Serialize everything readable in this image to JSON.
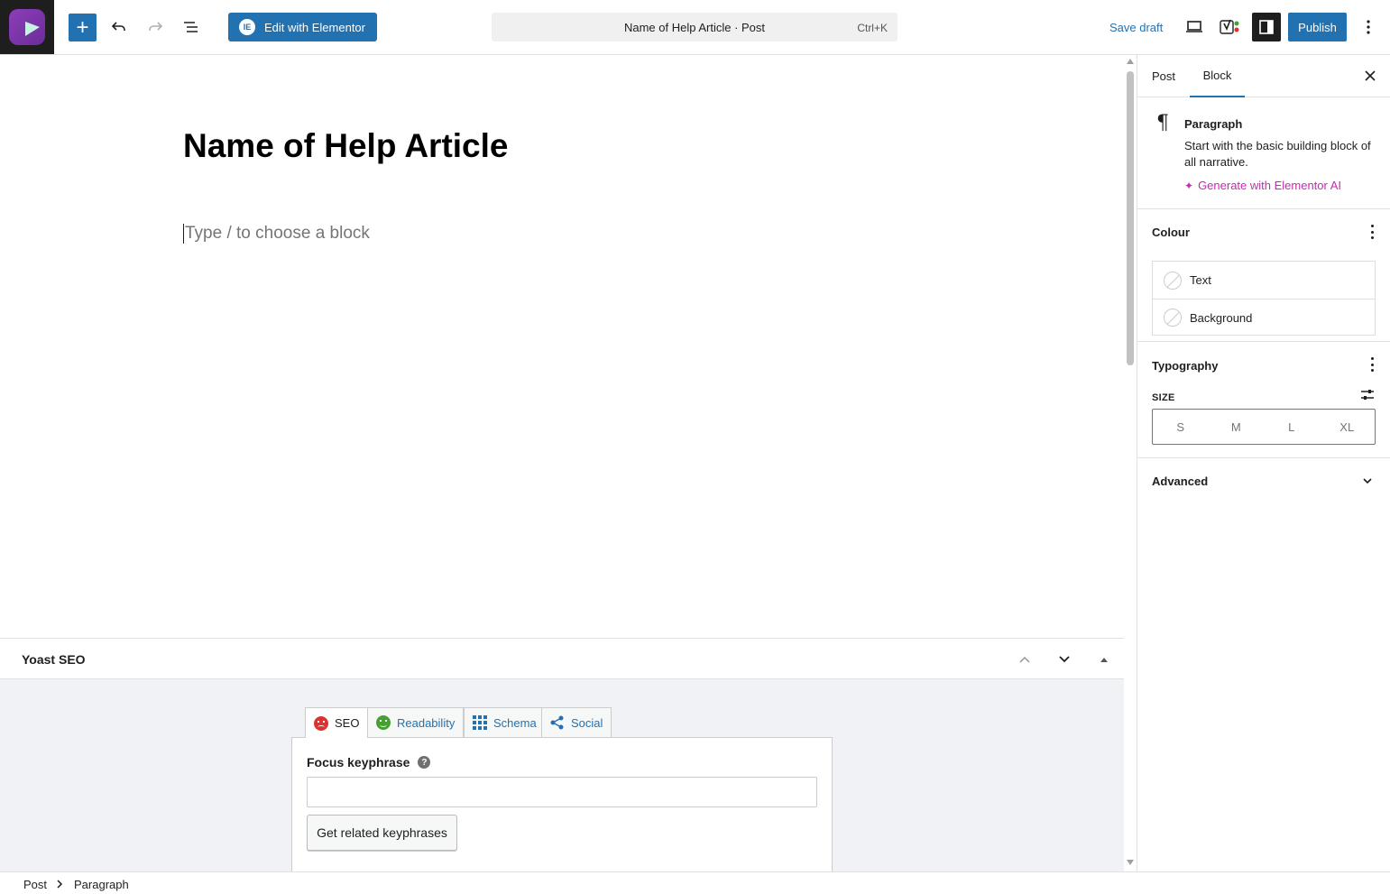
{
  "toolbar": {
    "edit_with_elementor": "Edit with Elementor",
    "e_logo_letter": "IE",
    "command_title": "Name of Help Article · Post",
    "command_shortcut": "Ctrl+K",
    "save_draft": "Save draft",
    "publish": "Publish"
  },
  "editor": {
    "post_title": "Name of Help Article",
    "block_placeholder": "Type / to choose a block"
  },
  "yoast": {
    "title": "Yoast SEO",
    "tabs": [
      {
        "label": "SEO",
        "icon": "sad-face-icon",
        "status_color": "#dc3232"
      },
      {
        "label": "Readability",
        "icon": "smile-face-icon",
        "status_color": "#46a030"
      },
      {
        "label": "Schema",
        "icon": "grid-icon"
      },
      {
        "label": "Social",
        "icon": "share-icon"
      }
    ],
    "focus_keyphrase_label": "Focus keyphrase",
    "focus_keyphrase_value": "",
    "related_button": "Get related keyphrases"
  },
  "sidebar": {
    "tabs": [
      "Post",
      "Block"
    ],
    "active_tab": "Block",
    "block": {
      "name": "Paragraph",
      "description": "Start with the basic building block of all narrative.",
      "generate_ai": "Generate with Elementor AI"
    },
    "colour": {
      "title": "Colour",
      "items": [
        "Text",
        "Background"
      ]
    },
    "typography": {
      "title": "Typography",
      "size_label": "SIZE",
      "sizes": [
        "S",
        "M",
        "L",
        "XL"
      ]
    },
    "advanced": {
      "title": "Advanced"
    }
  },
  "breadcrumb": {
    "items": [
      "Post",
      "Paragraph"
    ]
  },
  "colors": {
    "accent": "#2271b1",
    "ai_pink": "#c72ab1",
    "toolbar_dark": "#1e1e1e"
  }
}
